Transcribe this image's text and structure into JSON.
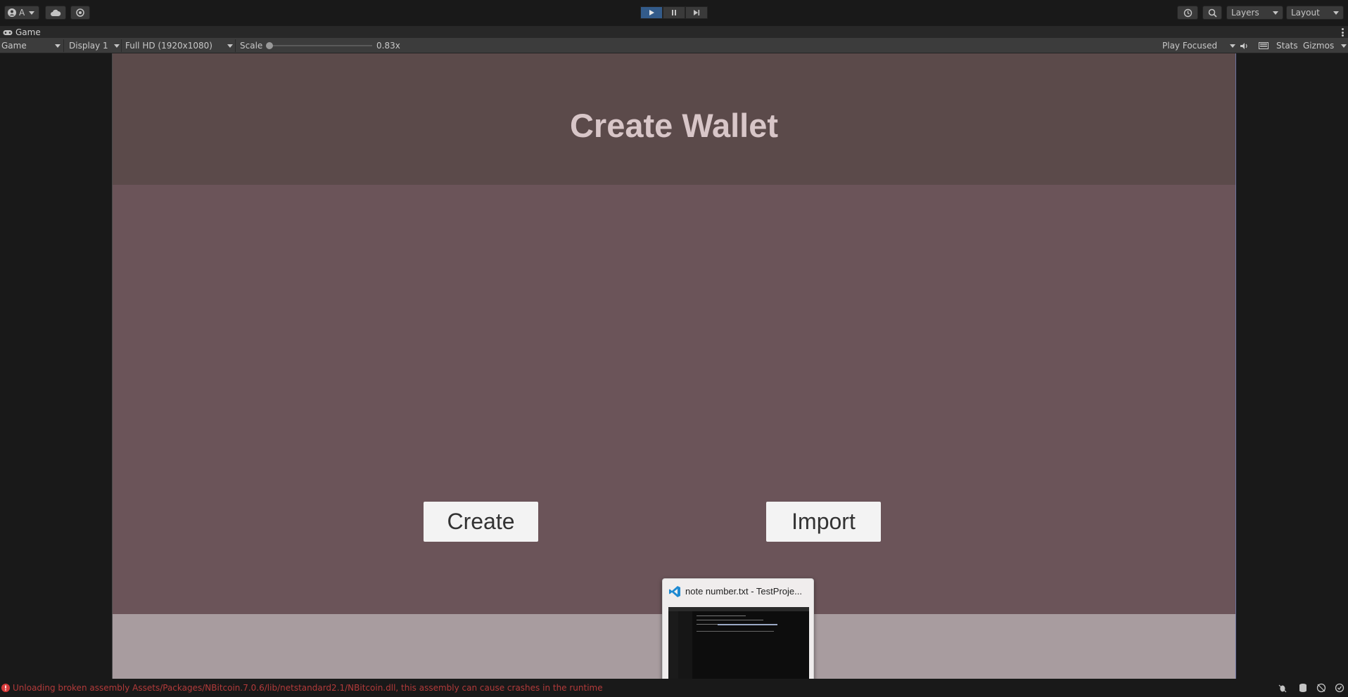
{
  "toolbar": {
    "account_label": "A",
    "play_tooltip": "Play",
    "layers_label": "Layers",
    "layout_label": "Layout"
  },
  "tab": {
    "label": "Game"
  },
  "gamebar": {
    "view_mode": "Game",
    "display": "Display 1",
    "resolution": "Full HD (1920x1080)",
    "scale_label": "Scale",
    "scale_value": "0.83x",
    "play_mode": "Play Focused",
    "stats_label": "Stats",
    "gizmos_label": "Gizmos"
  },
  "game": {
    "title": "Create Wallet",
    "create_label": "Create",
    "import_label": "Import"
  },
  "thumbnail": {
    "title": "note number.txt - TestProje..."
  },
  "status": {
    "message": "Unloading broken assembly Assets/Packages/NBitcoin.7.0.6/lib/netstandard2.1/NBitcoin.dll, this assembly can cause crashes in the runtime"
  },
  "colors": {
    "editor_bg": "#191919",
    "header_band": "#5b4a4a",
    "main_band": "#6b5459",
    "bottom_band": "#a89c9f",
    "error_text": "#b23a3a",
    "play_active": "#335b8a"
  }
}
